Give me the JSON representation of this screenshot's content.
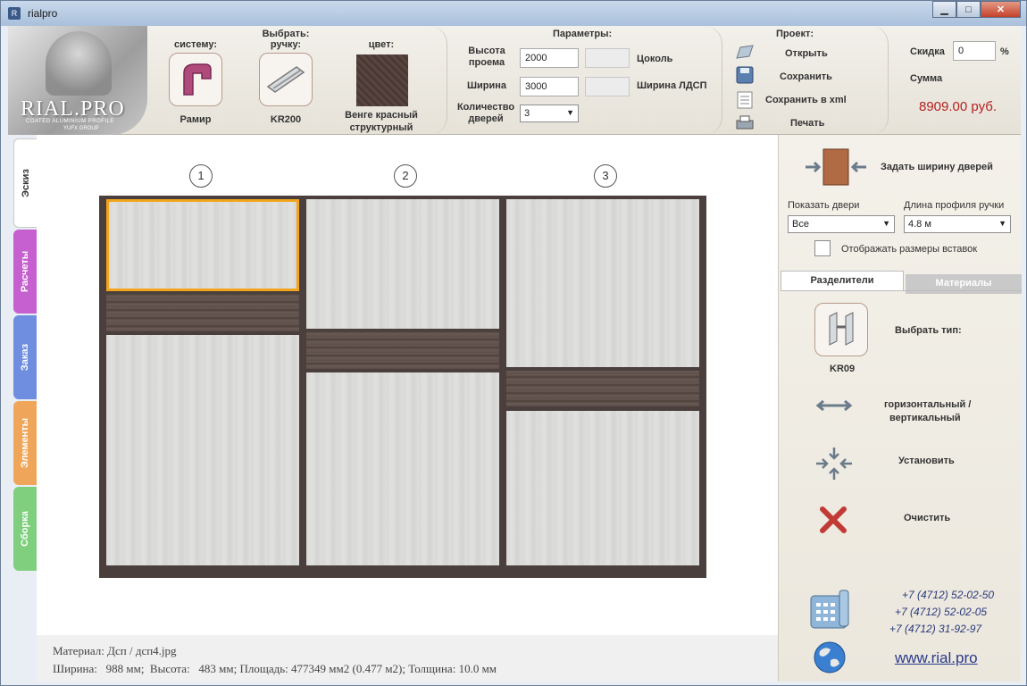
{
  "window": {
    "title": "rialpro",
    "minimize": "▁",
    "maximize": "□",
    "close": "✕"
  },
  "logo": {
    "brand": "RIAL.PRO",
    "tagline": "COATED ALUMINIUM PROFILE",
    "group": "YUFX GROUP"
  },
  "selectors": {
    "system": {
      "title": "систему:",
      "value": "Рамир",
      "color": "#b04a7a"
    },
    "handle": {
      "title": "Выбрать:\nручку:",
      "title_line1": "Выбрать:",
      "title_line2": "ручку:",
      "value": "KR200"
    },
    "color": {
      "title": "цвет:",
      "value_line1": "Венге красный",
      "value_line2": "структурный",
      "swatch": "#4b3a35"
    }
  },
  "params": {
    "title": "Параметры:",
    "height_label_1": "Высота",
    "height_label_2": "проема",
    "height_value": "2000",
    "plinth_label": "Цоколь",
    "width_label": "Ширина",
    "width_value": "3000",
    "ldsp_label": "Ширина ЛДСП",
    "doors_label_1": "Количество",
    "doors_label_2": "дверей",
    "doors_value": "3"
  },
  "project": {
    "title": "Проект:",
    "open": "Открыть",
    "save": "Сохранить",
    "save_xml": "Сохранить в xml",
    "print": "Печать"
  },
  "pricing": {
    "discount_label": "Скидка",
    "discount_value": "0",
    "percent": "%",
    "sum_label": "Сумма",
    "sum_value": "8909.00 руб."
  },
  "left_tabs": [
    {
      "label": "Эскиз",
      "color": "#ffffff"
    },
    {
      "label": "Расчеты",
      "color": "#c65fd0"
    },
    {
      "label": "Заказ",
      "color": "#6f8ee0"
    },
    {
      "label": "Элементы",
      "color": "#f0a65a"
    },
    {
      "label": "Сборка",
      "color": "#7fcf7f"
    }
  ],
  "doors": {
    "numbers": [
      "1",
      "2",
      "3"
    ]
  },
  "status": {
    "material": "Материал: Дсп / дсп4.jpg",
    "dims": "Ширина:   988 мм;  Высота:   483 мм; Площадь: 477349 мм2 (0.477 м2); Толщина: 10.0 мм"
  },
  "right_panel": {
    "set_width": "Задать ширину дверей",
    "show_doors_label": "Показать двери",
    "show_doors_value": "Все",
    "handle_len_label": "Длина профиля ручки",
    "handle_len_value": "4.8 м",
    "show_sizes": "Отображать размеры вставок",
    "tab_dividers": "Разделители",
    "tab_materials": "Материалы",
    "choose_type": "Выбрать тип:",
    "type_value": "KR09",
    "orientation_1": "горизонтальный /",
    "orientation_2": "вертикальный",
    "install": "Установить",
    "clear": "Очистить",
    "phones": [
      "+7 (4712) 52-02-50",
      "+7 (4712) 52-02-05",
      "+7 (4712) 31-92-97"
    ],
    "website": "www.rial.pro"
  }
}
